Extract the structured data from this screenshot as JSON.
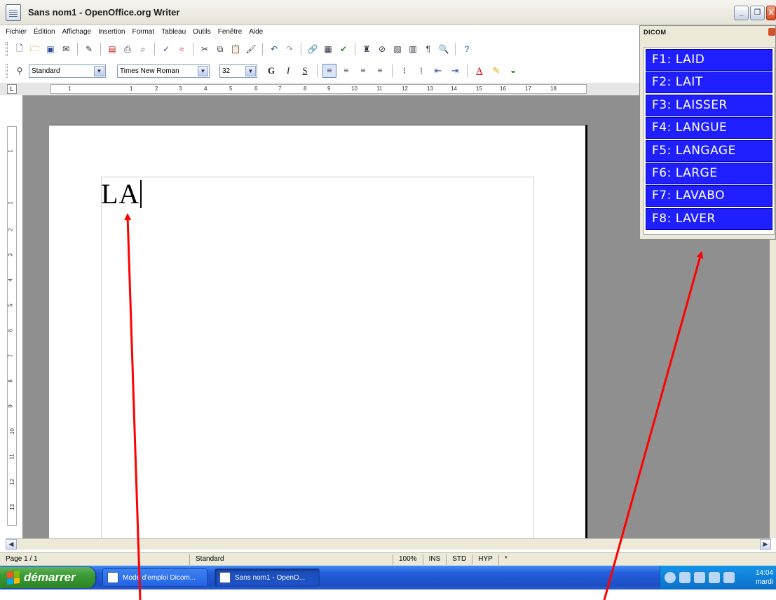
{
  "window": {
    "title": "Sans nom1 - OpenOffice.org Writer",
    "minimize_label": "_",
    "restore_label": "❐",
    "close_label": "X"
  },
  "menubar": {
    "items": [
      "Fichier",
      "Édition",
      "Affichage",
      "Insertion",
      "Format",
      "Tableau",
      "Outils",
      "Fenêtre",
      "Aide"
    ]
  },
  "formatting": {
    "style": "Standard",
    "font": "Times New Roman",
    "size": "32",
    "bold_label": "G",
    "italic_label": "I",
    "underline_label": "S"
  },
  "ruler": {
    "horizontal": [
      "1",
      "1",
      "2",
      "3",
      "4",
      "5",
      "6",
      "7",
      "8",
      "9",
      "10",
      "11",
      "12",
      "13",
      "14",
      "15",
      "16",
      "17",
      "18"
    ],
    "vertical": [
      "1",
      "1",
      "2",
      "3",
      "4",
      "5",
      "6",
      "7",
      "8",
      "9",
      "10",
      "11",
      "12",
      "13"
    ],
    "corner_label": "L"
  },
  "document": {
    "text": "LA"
  },
  "dicom": {
    "title": "DICOM",
    "suggestions": [
      "F1: LAID",
      "F2: LAIT",
      "F3: LAISSER",
      "F4: LANGUE",
      "F5: LANGAGE",
      "F6: LARGE",
      "F7: LAVABO",
      "F8: LAVER"
    ],
    "item_color": "#1f1fff"
  },
  "statusbar": {
    "page": "Page 1 / 1",
    "style": "Standard",
    "zoom": "100%",
    "insert_mode": "INS",
    "selection_mode": "STD",
    "hyperlink_mode": "HYP",
    "modified": "*"
  },
  "taskbar": {
    "start_label": "démarrer",
    "tasks": [
      "Mode d'emploi Dicom...",
      "Sans nom1 - OpenO..."
    ],
    "clock_time": "14:04",
    "clock_day": "mardi"
  },
  "annotation": {
    "arrow_color": "#ff0000"
  }
}
